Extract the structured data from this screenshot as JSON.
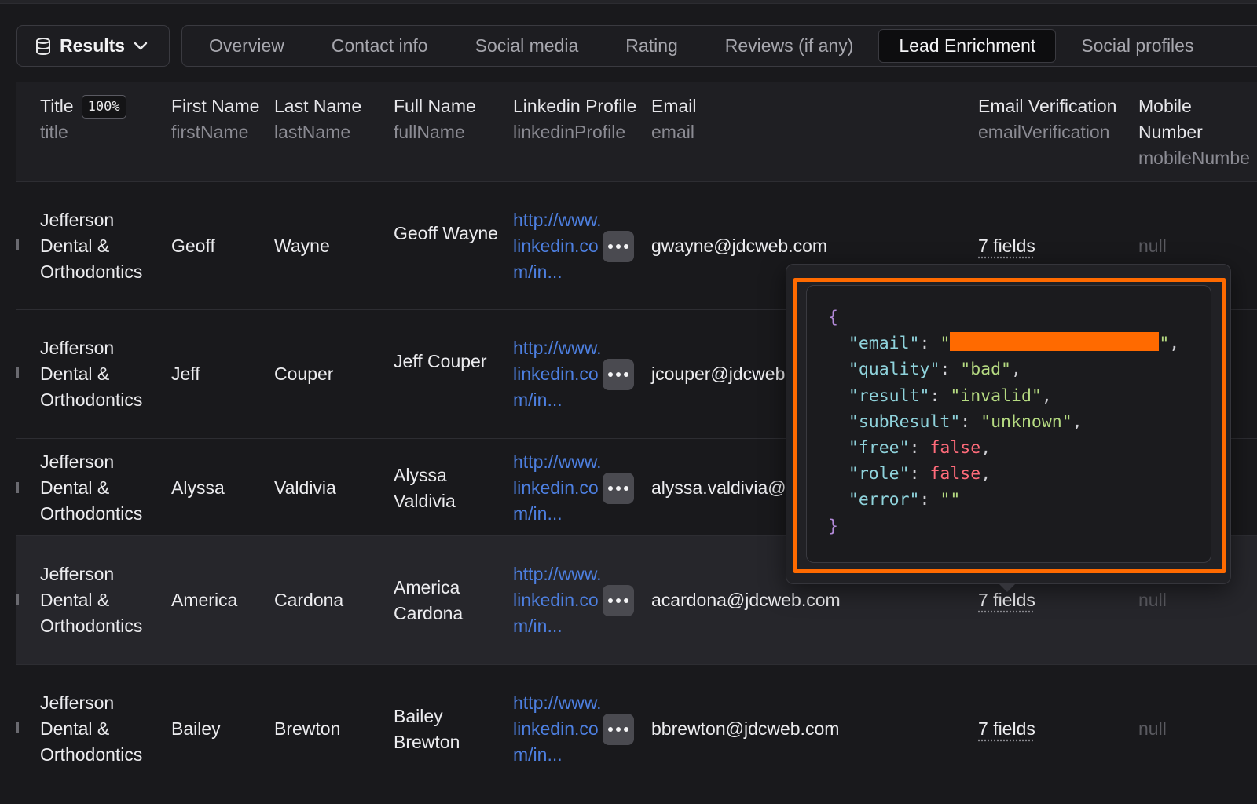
{
  "toolbar": {
    "results_label": "Results",
    "tabs": [
      "Overview",
      "Contact info",
      "Social media",
      "Rating",
      "Reviews (if any)",
      "Lead Enrichment",
      "Social profiles"
    ],
    "active_tab": "Lead Enrichment"
  },
  "table": {
    "headers": {
      "title": {
        "label": "Title",
        "key": "title",
        "badge": "100%"
      },
      "first": {
        "label": "First Name",
        "key": "firstName"
      },
      "last": {
        "label": "Last Name",
        "key": "lastName"
      },
      "full": {
        "label": "Full Name",
        "key": "fullName"
      },
      "link": {
        "label": "Linkedin Profile",
        "key": "linkedinProfile"
      },
      "email": {
        "label": "Email",
        "key": "email"
      },
      "ver": {
        "label": "Email Verification",
        "key": "emailVerification"
      },
      "mob": {
        "label": "Mobile Number",
        "key": "mobileNumbe"
      }
    },
    "rows": [
      {
        "title": "Jefferson Dental & Orthodontics",
        "first": "Geoff",
        "last": "Wayne",
        "full": "Geoff Wayne",
        "link": "http://www.linkedin.com/in...",
        "email": "gwayne@jdcweb.com",
        "ver": "7 fields",
        "mob": "null"
      },
      {
        "title": "Jefferson Dental & Orthodontics",
        "first": "Jeff",
        "last": "Couper",
        "full": "Jeff Couper",
        "link": "http://www.linkedin.com/in...",
        "email": "jcouper@jdcweb",
        "ver": "",
        "mob": ""
      },
      {
        "title": "Jefferson Dental & Orthodontics",
        "first": "Alyssa",
        "last": "Valdivia",
        "full": "Alyssa Valdivia",
        "link": "http://www.linkedin.com/in...",
        "email": "alyssa.valdivia@",
        "ver": "",
        "mob": ""
      },
      {
        "title": "Jefferson Dental & Orthodontics",
        "first": "America",
        "last": "Cardona",
        "full": "America Cardona",
        "link": "http://www.linkedin.com/in...",
        "email": "acardona@jdcweb.com",
        "ver": "7 fields",
        "mob": "null"
      },
      {
        "title": "Jefferson Dental & Orthodontics",
        "first": "Bailey",
        "last": "Brewton",
        "full": "Bailey Brewton",
        "link": "http://www.linkedin.com/in...",
        "email": "bbrewton@jdcweb.com",
        "ver": "7 fields",
        "mob": "null"
      }
    ]
  },
  "popover": {
    "open_brace": "{",
    "close_brace": "}",
    "lines": [
      {
        "key": "\"email\"",
        "value": "\"",
        "value_end": "\"",
        "redacted": true,
        "type": "str"
      },
      {
        "key": "\"quality\"",
        "value": "\"bad\"",
        "type": "str"
      },
      {
        "key": "\"result\"",
        "value": "\"invalid\"",
        "type": "str"
      },
      {
        "key": "\"subResult\"",
        "value": "\"unknown\"",
        "type": "str"
      },
      {
        "key": "\"free\"",
        "value": "false",
        "type": "bool"
      },
      {
        "key": "\"role\"",
        "value": "false",
        "type": "bool"
      },
      {
        "key": "\"error\"",
        "value": "\"\"",
        "type": "str",
        "last": true
      }
    ]
  },
  "colors": {
    "highlight": "#ff6a00",
    "link": "#4d7fe0",
    "background": "#19191c"
  }
}
